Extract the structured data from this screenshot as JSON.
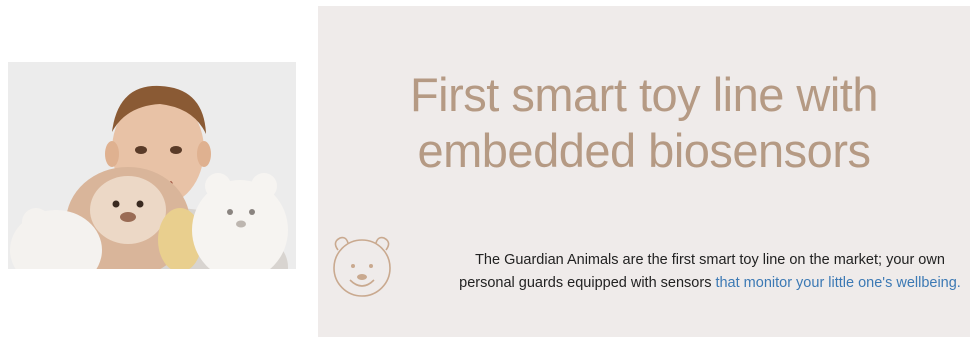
{
  "photo": {
    "alt": "Child hugging plush toys"
  },
  "banner": {
    "headline_line1": "First smart toy line with",
    "headline_line2": "embedded biosensors",
    "description_text": "The Guardian Animals are the first smart toy line on the market; your own personal guards equipped with sensors ",
    "description_link": "that monitor your little one's wellbeing.",
    "colors": {
      "headline": "#b59a84",
      "background": "#efebea",
      "link": "#3c79b4",
      "icon": "#c9a98f"
    },
    "icon": "bear-face-icon"
  }
}
